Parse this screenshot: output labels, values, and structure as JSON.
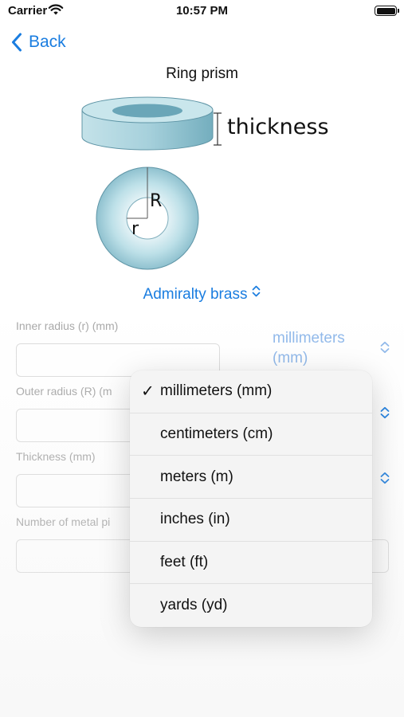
{
  "status": {
    "carrier": "Carrier",
    "time": "10:57 PM"
  },
  "nav": {
    "back_label": "Back"
  },
  "page": {
    "title": "Ring prism"
  },
  "illustration": {
    "thickness_label": "thickness",
    "outer_radius_label": "R",
    "inner_radius_label": "r"
  },
  "material": {
    "selected": "Admiralty brass"
  },
  "form": {
    "inner_radius_label": "Inner radius  (r) (mm)",
    "inner_radius_value": "",
    "inner_radius_unit": "millimeters (mm)",
    "outer_radius_label": "Outer radius (R) (m",
    "outer_radius_value": "",
    "thickness_label": "Thickness (mm)",
    "thickness_value": "",
    "pieces_label": "Number of metal pi",
    "pieces_value": ""
  },
  "unit_menu": {
    "selected_index": 0,
    "items": [
      "millimeters (mm)",
      "centimeters (cm)",
      "meters (m)",
      "inches (in)",
      "feet (ft)",
      "yards (yd)"
    ]
  },
  "colors": {
    "accent": "#1a7de0",
    "ring_fill": "#aed6df",
    "ring_dark": "#6fa6b6"
  }
}
